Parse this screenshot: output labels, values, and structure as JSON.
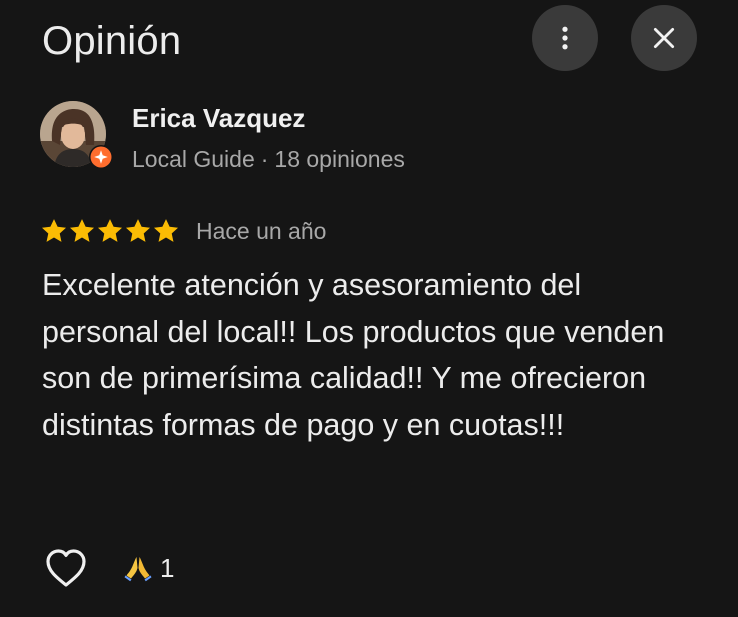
{
  "header": {
    "title": "Opinión",
    "more_icon": "more-vert-icon",
    "close_icon": "close-icon"
  },
  "review": {
    "author": {
      "name": "Erica Vazquez",
      "level": "Local Guide",
      "separator": "·",
      "reviews_count": "18 opiniones",
      "badge_icon": "local-guide-star-icon",
      "badge_color": "#ff6d2e"
    },
    "rating": {
      "stars": 5,
      "max": 5,
      "star_color": "#fbbc04"
    },
    "time": "Hace un año",
    "text": "Excelente atención y asesoramiento del personal del local!! Los productos que venden son de primerísima calidad!! Y me ofrecieron distintas formas de pago y en cuotas!!!",
    "actions": {
      "like_icon": "heart-outline-icon",
      "reaction_icon": "folded-hands-emoji",
      "reaction_count": "1"
    }
  },
  "colors": {
    "background": "#151515",
    "button_bg": "#3a3a3a",
    "text_primary": "#ececec",
    "text_secondary": "#a8a8a8"
  }
}
